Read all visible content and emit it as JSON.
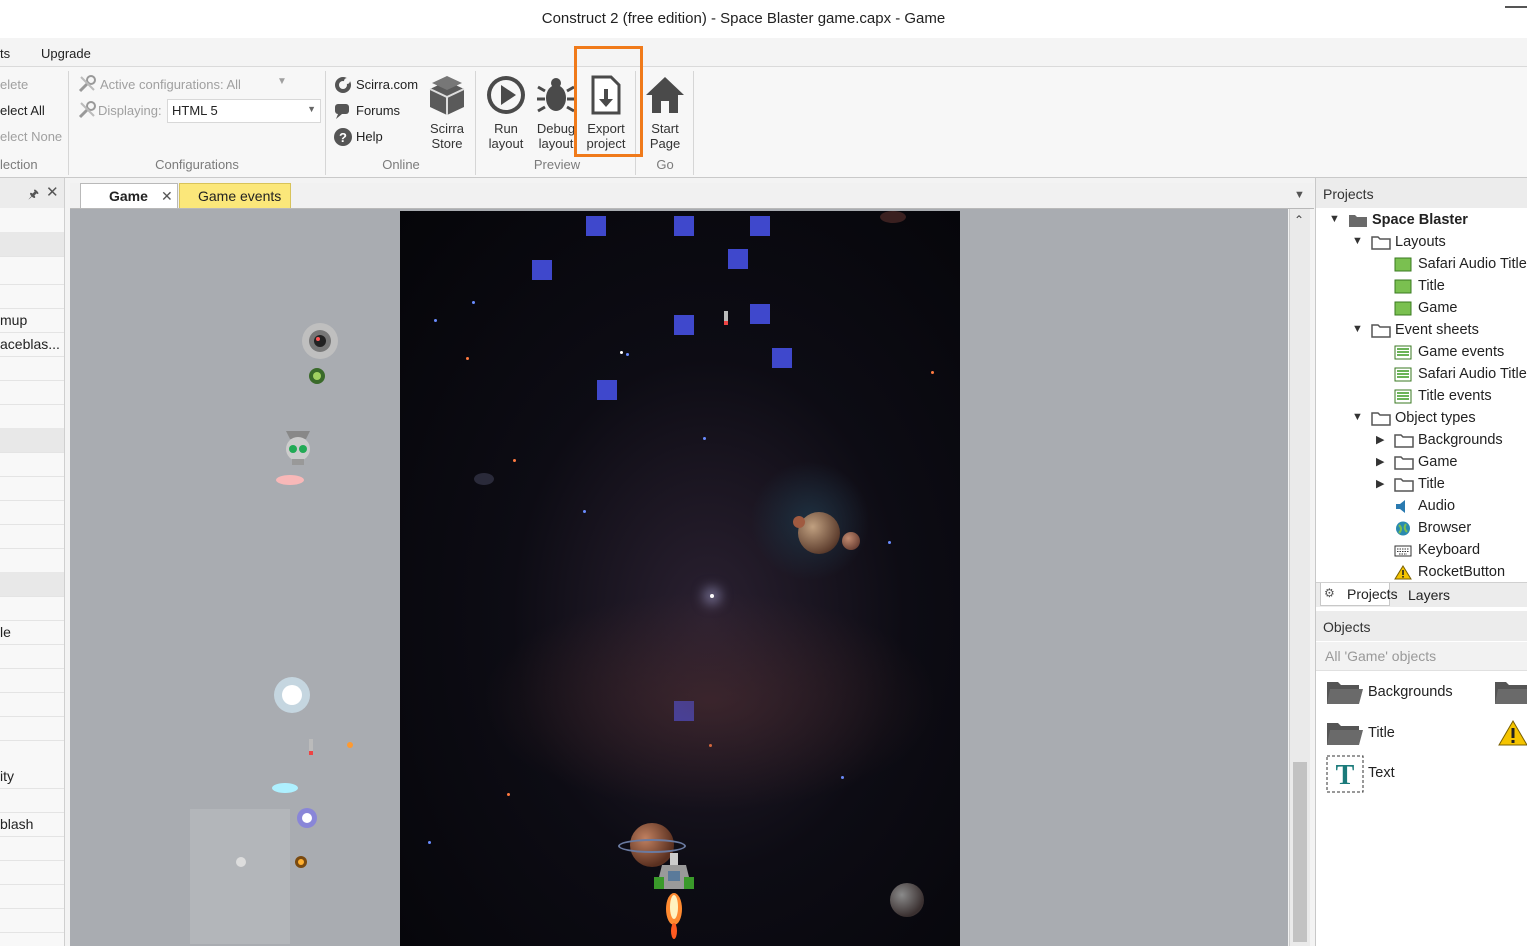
{
  "window": {
    "title": "Construct 2  (free edition) - Space Blaster game.capx - Game"
  },
  "menu": {
    "items": [
      "ts",
      "Upgrade"
    ]
  },
  "ribbon": {
    "selection": {
      "delete": "elete",
      "select_all": "elect All",
      "select_none": "elect None",
      "group_label": "lection"
    },
    "configurations": {
      "active": "Active configurations: All",
      "displaying_label": "Displaying:",
      "displaying_value": "HTML 5",
      "group_label": "Configurations"
    },
    "online": {
      "scirra": "Scirra.com",
      "forums": "Forums",
      "help": "Help",
      "store_line1": "Scirra",
      "store_line2": "Store",
      "group_label": "Online"
    },
    "preview": {
      "run_line1": "Run",
      "run_line2": "layout",
      "debug_line1": "Debug",
      "debug_line2": "layout",
      "export_line1": "Export",
      "export_line2": "project",
      "group_label": "Preview"
    },
    "go": {
      "start_line1": "Start",
      "start_line2": "Page",
      "group_label": "Go"
    }
  },
  "left_panel": {
    "rows": [
      "mup",
      "aceblas...",
      "le",
      "ity",
      "blash"
    ]
  },
  "tabs": [
    {
      "label": "Game",
      "close": "✕"
    },
    {
      "label": "Game events"
    }
  ],
  "projects": {
    "header": "Projects",
    "root": "Space Blaster",
    "layouts": {
      "label": "Layouts",
      "items": [
        "Safari Audio Title",
        "Title",
        "Game"
      ]
    },
    "event_sheets": {
      "label": "Event sheets",
      "items": [
        "Game events",
        "Safari Audio Title",
        "Title events"
      ]
    },
    "object_types": {
      "label": "Object types",
      "folders": [
        "Backgrounds",
        "Game",
        "Title"
      ],
      "items": [
        "Audio",
        "Browser",
        "Keyboard",
        "RocketButton"
      ]
    },
    "bottom_tabs": [
      "Projects",
      "Layers"
    ]
  },
  "objects": {
    "header": "Objects",
    "filter": "All 'Game' objects",
    "items": [
      "Backgrounds",
      "Title",
      "Text"
    ]
  },
  "colors": {
    "accent_highlight": "#f07a1a",
    "sprite_square": "#3f48cc",
    "event_tab": "#fbe77a"
  }
}
